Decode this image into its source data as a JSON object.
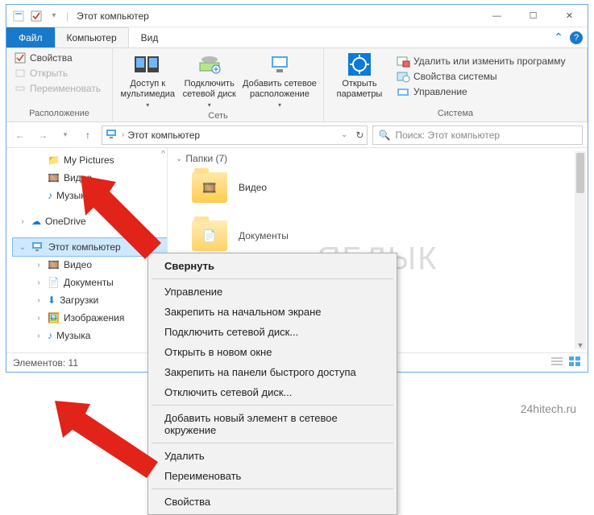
{
  "titlebar": {
    "title": "Этот компьютер"
  },
  "winbtns": {
    "minimize": "—",
    "maximize": "☐",
    "close": "✕"
  },
  "tabs": {
    "file": "Файл",
    "computer": "Компьютер",
    "view": "Вид"
  },
  "ribbon": {
    "group_location": {
      "label": "Расположение",
      "properties": "Свойства",
      "open": "Открыть",
      "rename": "Переименовать"
    },
    "group_network": {
      "label": "Сеть",
      "access_media": "Доступ к мультимедиа",
      "map_drive": "Подключить сетевой диск",
      "add_location": "Добавить сетевое расположение"
    },
    "group_system": {
      "label": "Система",
      "open_settings": "Открыть параметры",
      "uninstall": "Удалить или изменить программу",
      "sys_props": "Свойства системы",
      "manage": "Управление"
    }
  },
  "addr": {
    "location": "Этот компьютер"
  },
  "search": {
    "placeholder": "Поиск: Этот компьютер"
  },
  "tree": {
    "my_pictures": "My Pictures",
    "video": "Видео",
    "music": "Музыка",
    "onedrive": "OneDrive",
    "this_pc": "Этот компьютер",
    "video2": "Видео",
    "documents": "Документы",
    "downloads": "Загрузки",
    "images": "Изображения",
    "music2": "Музыка"
  },
  "content": {
    "group_header": "Папки (7)",
    "items": {
      "video": "Видео",
      "documents": "Документы"
    }
  },
  "status": {
    "count": "Элементов: 11"
  },
  "context_menu": {
    "collapse": "Свернуть",
    "manage": "Управление",
    "pin_start": "Закрепить на начальном экране",
    "map_drive": "Подключить сетевой диск...",
    "open_new_window": "Открыть в новом окне",
    "pin_quick": "Закрепить на панели быстрого доступа",
    "disconnect_drive": "Отключить сетевой диск...",
    "add_network_loc": "Добавить новый элемент в сетевое окружение",
    "delete": "Удалить",
    "rename": "Переименовать",
    "properties": "Свойства"
  },
  "watermark": "ЯБЛЫК",
  "attribution": "24hitech.ru"
}
